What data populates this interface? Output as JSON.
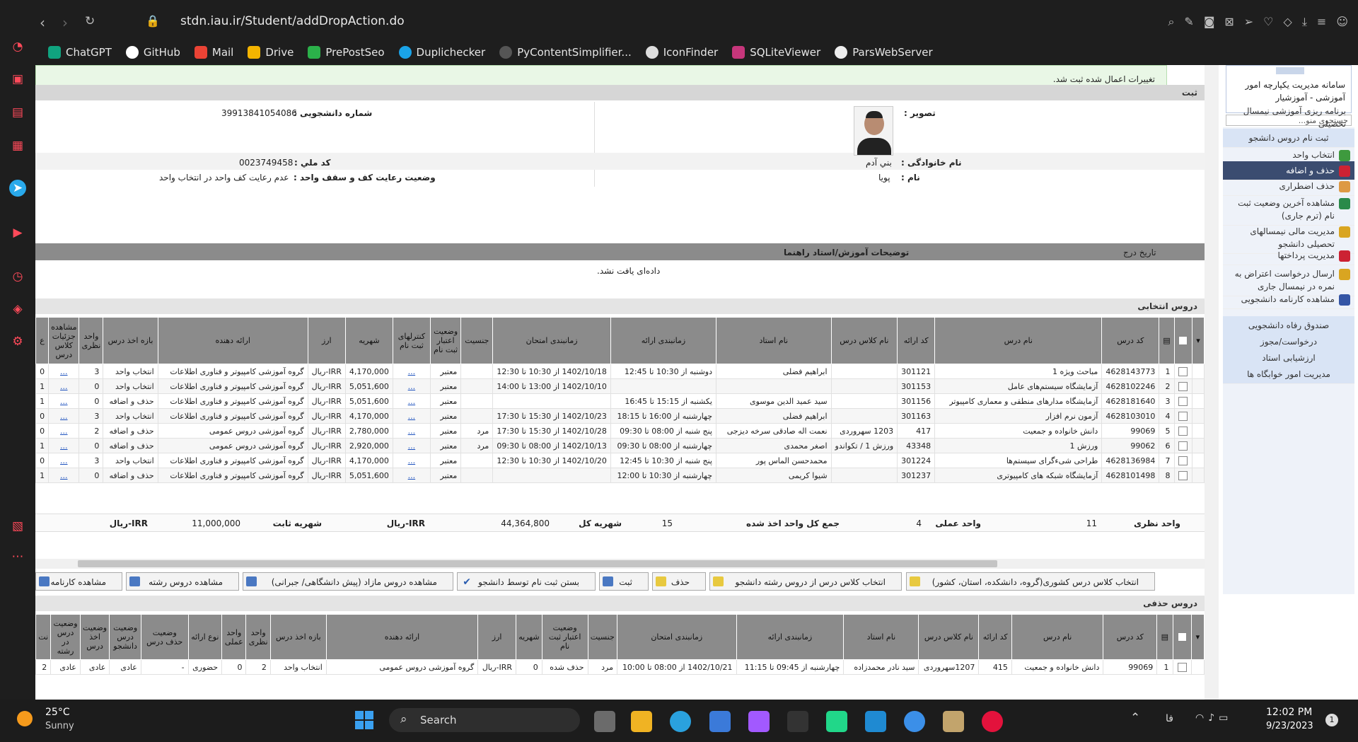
{
  "browser": {
    "url": "stdn.iau.ir/Student/addDropAction.do",
    "bookmarks": [
      "ChatGPT",
      "GitHub",
      "Mail",
      "Drive",
      "PrePostSeo",
      "Duplichecker",
      "PyContentSimplifier...",
      "IconFinder",
      "SQLiteViewer",
      "ParsWebServer"
    ]
  },
  "notice": "تغییرات اعمال شده ثبت شد.",
  "section_title": "ثبت",
  "profile": {
    "photo_label": "تصویر :",
    "student_no_label": "شماره دانشجویی :",
    "student_no": "39913841054086",
    "family_label": "نام خانوادگی :",
    "family": "بني آدم",
    "national_label": "کد ملي :",
    "national": "0023749458",
    "name_label": "نام :",
    "name": "پویا",
    "limit_label": "وضعیت رعایت کف و سقف واحد :",
    "limit": "عدم رعایت کف واحد در انتخاب واحد"
  },
  "notes": {
    "col_date": "تاریخ درج",
    "col_desc": "توضیحات آموزش/استاد راهنما",
    "empty": "داده‌ای یافت نشد."
  },
  "selected": {
    "title": "دروس انتخابی",
    "headers": [
      "",
      "",
      "کد درس",
      "نام درس",
      "کد ارائه",
      "نام کلاس درس",
      "نام استاد",
      "زمانبندی ارائه",
      "زمانبندی امتحان",
      "جنسیت",
      "وضعیت اعتبار ثبت نام",
      "کنترلهای ثبت نام",
      "شهریه",
      "ارز",
      "ارائه دهنده",
      "بازه اخذ درس",
      "واحد نظری",
      "مشاهده جزئیات کلاس درس",
      "ع"
    ],
    "rows": [
      [
        "1",
        "4628143773",
        "مباحث ویژه 1",
        "301121",
        "",
        "ابراهیم فضلی",
        "دوشنبه از 10:30 تا 12:45",
        "1402/10/18 از 10:30 تا 12:30",
        "",
        "معتبر",
        "...",
        "4,170,000",
        "IRR-ریال",
        "گروه آموزشی کامپیوتر و فناوری اطلاعات",
        "انتخاب واحد",
        "3",
        "...",
        "0"
      ],
      [
        "2",
        "4628102246",
        "آزمایشگاه سیستم‌های عامل",
        "301153",
        "",
        "",
        "",
        "1402/10/10 از 13:00 تا 14:00",
        "",
        "معتبر",
        "...",
        "5,051,600",
        "IRR-ریال",
        "گروه آموزشی کامپیوتر و فناوری اطلاعات",
        "انتخاب واحد",
        "0",
        "...",
        "1"
      ],
      [
        "3",
        "4628181640",
        "آزمایشگاه مدارهای منطقی و معماری کامپیوتر",
        "301156",
        "",
        "سید عمید الدین موسوی",
        "یکشنبه از 15:15 تا 16:45",
        "",
        "",
        "معتبر",
        "...",
        "5,051,600",
        "IRR-ریال",
        "گروه آموزشی کامپیوتر و فناوری اطلاعات",
        "حذف و اضافه",
        "0",
        "...",
        "1"
      ],
      [
        "4",
        "4628103010",
        "آزمون نرم افزار",
        "301163",
        "",
        "ابراهیم فضلی",
        "چهارشنبه از 16:00 تا 18:15",
        "1402/10/23 از 15:30 تا 17:30",
        "",
        "معتبر",
        "...",
        "4,170,000",
        "IRR-ریال",
        "گروه آموزشی کامپیوتر و فناوری اطلاعات",
        "انتخاب واحد",
        "3",
        "...",
        "0"
      ],
      [
        "5",
        "99069",
        "دانش خانواده و جمعیت",
        "417",
        "1203 سهروردی",
        "نعمت اله صادقی سرخه دیزجی",
        "پنج شنبه از 08:00 تا 09:30",
        "1402/10/28 از 15:30 تا 17:30",
        "مرد",
        "معتبر",
        "...",
        "2,780,000",
        "IRR-ریال",
        "گروه آموزشی دروس عمومی",
        "حذف و اضافه",
        "2",
        "...",
        "0"
      ],
      [
        "6",
        "99062",
        "ورزش 1",
        "43348",
        "ورزش 1 / تکواندو",
        "اصغر محمدی",
        "چهارشنبه از 08:00 تا 09:30",
        "1402/10/13 از 08:00 تا 09:30",
        "مرد",
        "معتبر",
        "...",
        "2,920,000",
        "IRR-ریال",
        "گروه آموزشی دروس عمومی",
        "حذف و اضافه",
        "0",
        "...",
        "1"
      ],
      [
        "7",
        "4628136984",
        "طراحی شیءگرای سیستم‌ها",
        "301224",
        "",
        "محمدحسن الماس پور",
        "پنج شنبه از 10:30 تا 12:45",
        "1402/10/20 از 10:30 تا 12:30",
        "",
        "معتبر",
        "...",
        "4,170,000",
        "IRR-ریال",
        "گروه آموزشی کامپیوتر و فناوری اطلاعات",
        "انتخاب واحد",
        "3",
        "...",
        "0"
      ],
      [
        "8",
        "4628101498",
        "آزمایشگاه شبکه های کامپیوتری",
        "301237",
        "",
        "شیوا کریمی",
        "چهارشنبه از 10:30 تا 12:00",
        "",
        "",
        "معتبر",
        "...",
        "5,051,600",
        "IRR-ریال",
        "گروه آموزشی کامپیوتر و فناوری اطلاعات",
        "حذف و اضافه",
        "0",
        "...",
        "1"
      ]
    ],
    "totals": {
      "theory_label": "واحد نظری",
      "theory": "11",
      "practical_label": "واحد عملی",
      "practical": "4",
      "sum_label": "جمع کل واحد اخذ شده",
      "sum": "15",
      "fee_label": "شهریه کل",
      "fee": "44,364,800",
      "fee_cur": "IRR-ریال",
      "fixed_label": "شهریه ثابت",
      "fixed": "11,000,000",
      "fixed_cur": "IRR-ریال"
    }
  },
  "actions": [
    "انتخاب کلاس درس کشوری(گروه، دانشکده، استان، کشور)",
    "انتخاب کلاس درس از دروس رشته دانشجو",
    "حذف",
    "ثبت",
    "بستن ثبت نام توسط دانشجو",
    "مشاهده دروس مازاد (پیش دانشگاهی/ جبرانی)",
    "مشاهده دروس رشته",
    "مشاهده کارنامه"
  ],
  "deleted": {
    "title": "دروس حذفی",
    "headers": [
      "",
      "",
      "کد درس",
      "نام درس",
      "کد ارائه",
      "نام کلاس درس",
      "نام استاد",
      "زمانبندی ارائه",
      "زمانبندی امتحان",
      "جنسیت",
      "وضعیت اعتبار ثبت نام",
      "شهریه",
      "ارز",
      "ارائه دهنده",
      "بازه اخذ درس",
      "واحد نظری",
      "واحد عملی",
      "نوع ارائه",
      "وضعیت حذف درس",
      "وضعیت درس دانشجو",
      "وضعیت اخذ درس",
      "وضعیت درس در رشته",
      "نت"
    ],
    "rows": [
      [
        "1",
        "99069",
        "دانش خانواده و جمعیت",
        "415",
        "1207سهروردی",
        "سید نادر محمدزاده",
        "چهارشنبه از 09:45 تا 11:15",
        "1402/10/21 از 08:00 تا 10:00",
        "مرد",
        "حذف شده",
        "0",
        "IRR-ریال",
        "گروه آموزشی دروس عمومی",
        "انتخاب واحد",
        "2",
        "0",
        "حضوری",
        "-",
        "عادی",
        "عادی",
        "عادی",
        "2"
      ]
    ]
  },
  "nav": {
    "logo_line1": "سامانه مدیریت یکپارچه امور",
    "logo_line2": "آموزشی - آموزشیار",
    "search": "جستجوی منو...",
    "items": [
      "برنامه ریزی آموزشی نیمسال تحصیلی",
      "ثبت نام دروس دانشجو",
      "انتخاب واحد",
      "حذف و اضافه",
      "حذف اضطراری",
      "مشاهده آخرین وضعیت ثبت نام (ترم جاری)",
      "مدیریت مالی نیمسالهای تحصیلی دانشجو",
      "مدیریت پرداختها",
      "ارسال درخواست اعتراض به نمره در نیمسال جاری",
      "مشاهده کارنامه دانشجویی",
      "صندوق رفاه دانشجویی",
      "درخواست/مجوز",
      "ارزشیابی استاد",
      "مدیریت امور خوابگاه ها"
    ]
  },
  "taskbar": {
    "temp": "25°C",
    "weather": "Sunny",
    "search": "Search",
    "lang": "فا",
    "time": "12:02 PM",
    "date": "9/23/2023",
    "badge": "1"
  }
}
